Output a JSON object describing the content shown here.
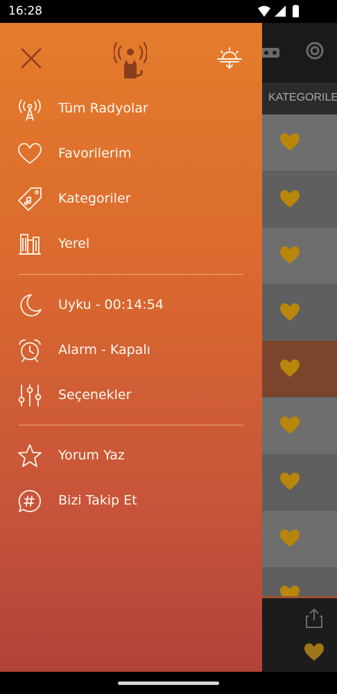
{
  "status_bar": {
    "time": "16:28"
  },
  "background_app": {
    "tab_label": "KATEGORILE",
    "row_colors": [
      "#6e6e6e",
      "#5f5f5f",
      "#6e6e6e",
      "#5f5f5f",
      "#7a452c",
      "#6e6e6e",
      "#5f5f5f",
      "#6e6e6e",
      "#5f5f5f"
    ],
    "heart_color": "#b8860b"
  },
  "drawer": {
    "colors": {
      "accent_icon": "#8a3d1f",
      "text": "#fff8f0"
    },
    "menu_group_1": [
      {
        "label": "Tüm Radyolar",
        "icon": "antenna-icon"
      },
      {
        "label": "Favorilerim",
        "icon": "heart-icon"
      },
      {
        "label": "Kategoriler",
        "icon": "tag-icon"
      },
      {
        "label": "Yerel",
        "icon": "city-icon"
      }
    ],
    "menu_group_2": [
      {
        "label": "Uyku - 00:14:54",
        "icon": "moon-icon"
      },
      {
        "label": "Alarm - Kapalı",
        "icon": "alarm-clock-icon"
      },
      {
        "label": "Seçenekler",
        "icon": "sliders-icon"
      }
    ],
    "menu_group_3": [
      {
        "label": "Yorum Yaz",
        "icon": "star-icon"
      },
      {
        "label": "Bizi Takip Et",
        "icon": "hashtag-icon"
      }
    ]
  }
}
